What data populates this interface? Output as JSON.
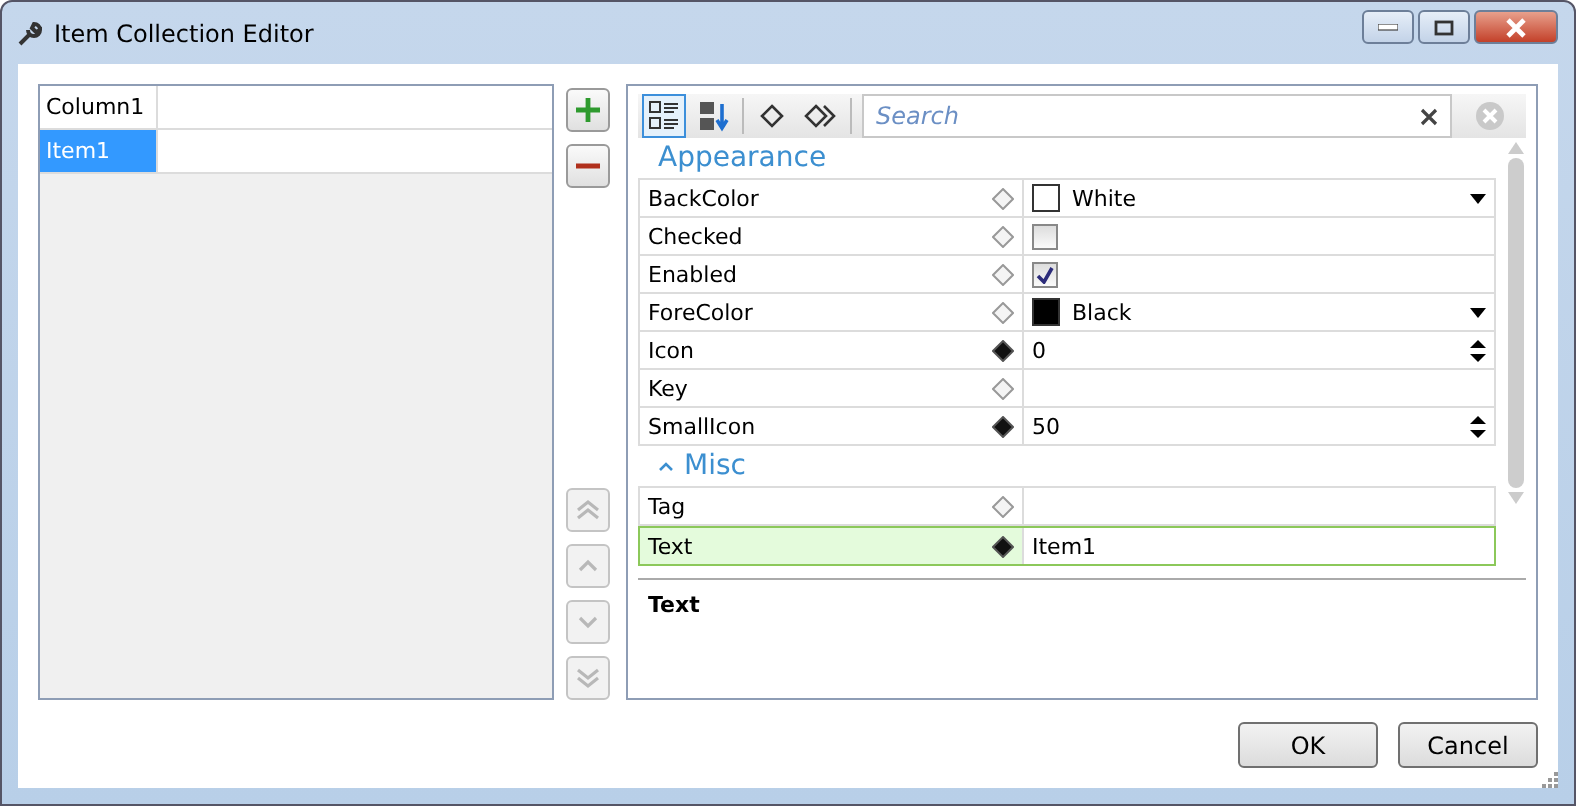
{
  "window": {
    "title": "Item Collection Editor"
  },
  "list": {
    "columns": [
      "Column1"
    ],
    "rows": [
      {
        "cells": [
          "Item1"
        ],
        "selected": true
      }
    ]
  },
  "toolbar": {
    "categorized_selected": true,
    "alphabetical_selected": false,
    "search": {
      "placeholder": "Search"
    }
  },
  "categories": [
    {
      "name": "Appearance",
      "properties": [
        {
          "name": "BackColor",
          "modified": false,
          "kind": "color",
          "value": "White",
          "color": "#ffffff",
          "selected": false
        },
        {
          "name": "Checked",
          "modified": false,
          "kind": "checkbox",
          "checked": false,
          "selected": false
        },
        {
          "name": "Enabled",
          "modified": false,
          "kind": "checkbox",
          "checked": true,
          "selected": false
        },
        {
          "name": "ForeColor",
          "modified": false,
          "kind": "color",
          "value": "Black",
          "color": "#000000",
          "selected": false
        },
        {
          "name": "Icon",
          "modified": true,
          "kind": "number",
          "value": "0",
          "selected": false
        },
        {
          "name": "Key",
          "modified": false,
          "kind": "text",
          "selected": false
        },
        {
          "name": "SmallIcon",
          "modified": true,
          "kind": "number",
          "value": "50",
          "selected": false
        }
      ]
    },
    {
      "name": "Misc",
      "expanded": true,
      "properties": [
        {
          "name": "Tag",
          "modified": false,
          "kind": "text",
          "selected": false
        },
        {
          "name": "Text",
          "modified": true,
          "kind": "text",
          "value": "Item1",
          "selected": true
        }
      ]
    }
  ],
  "description": {
    "title": "Text"
  },
  "buttons": [
    "OK",
    "Cancel"
  ]
}
